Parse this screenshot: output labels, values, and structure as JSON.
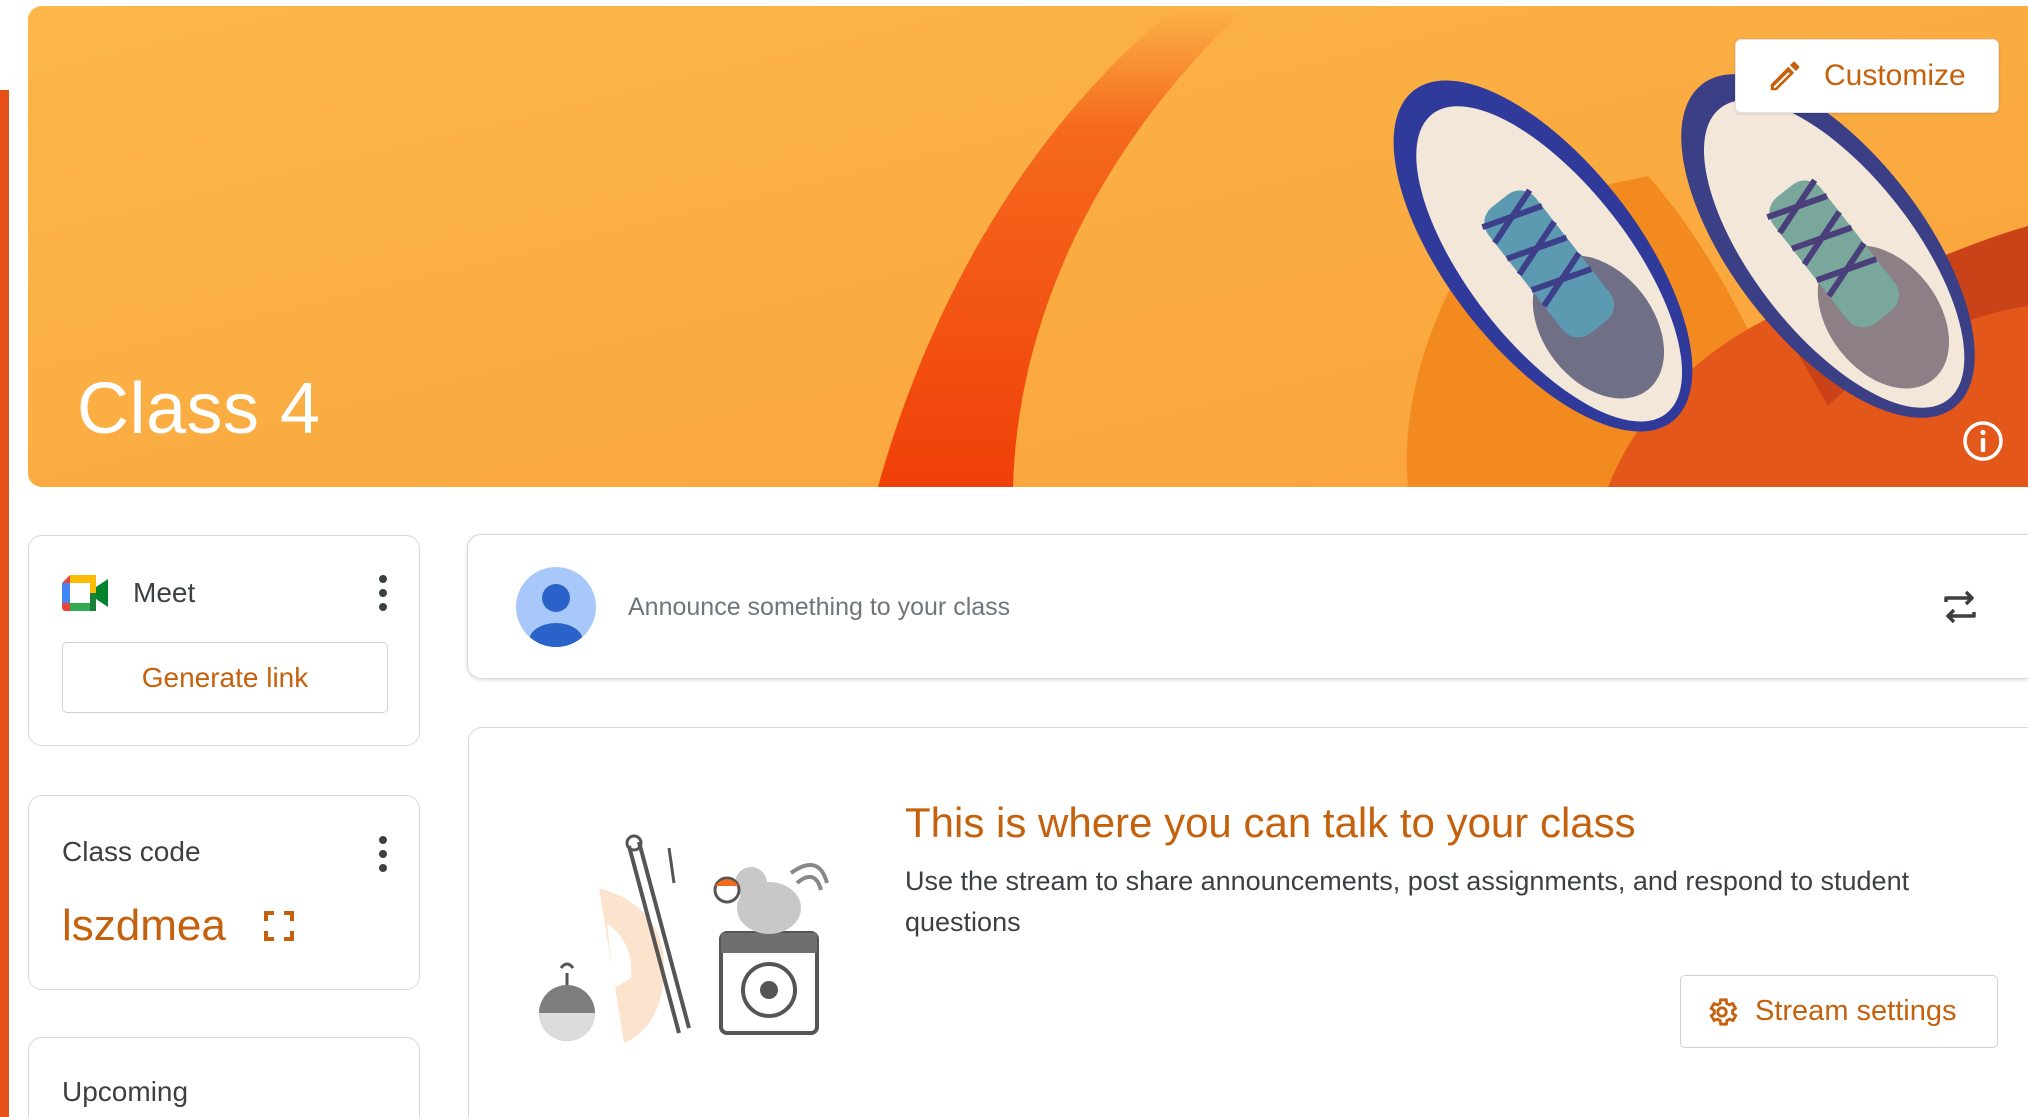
{
  "banner": {
    "title": "Class 4",
    "customize_label": "Customize"
  },
  "meet": {
    "label": "Meet",
    "generate_link_label": "Generate link"
  },
  "class_code": {
    "label": "Class code",
    "value": "lszdmea"
  },
  "upcoming": {
    "label": "Upcoming"
  },
  "announce": {
    "placeholder": "Announce something to your class"
  },
  "stream_info": {
    "title": "This is where you can talk to your class",
    "description": "Use the stream to share announcements, post assignments, and respond to student questions",
    "settings_label": "Stream settings"
  },
  "colors": {
    "accent": "#c5610c",
    "banner": "#fbb346",
    "stripe": "#f24a10"
  }
}
